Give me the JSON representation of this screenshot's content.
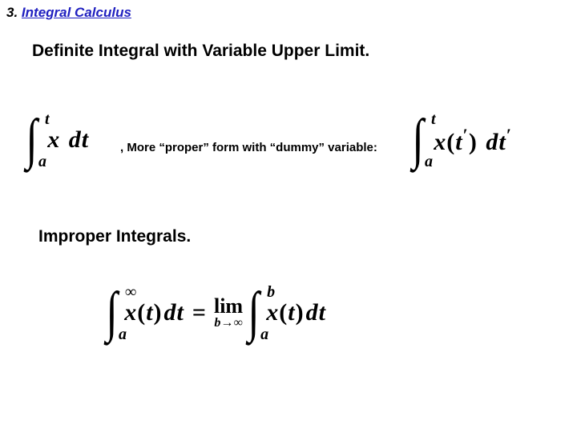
{
  "chapter": {
    "number": "3.",
    "title": "Integral Calculus"
  },
  "heading1": "Definite Integral with Variable Upper Limit.",
  "middle_note": ", More “proper” form with “dummy” variable:",
  "heading2": "Improper Integrals.",
  "eq1": {
    "lower": "a",
    "upper": "t",
    "integrand": "x",
    "diff": "dt"
  },
  "eq2": {
    "lower": "a",
    "upper": "t",
    "integrand_fn": "x",
    "arg": "t",
    "prime": "′",
    "diff_var": "t"
  },
  "eq3": {
    "lhs": {
      "lower": "a",
      "upper": "∞",
      "fn": "x",
      "arg": "t",
      "diff": "dt"
    },
    "lim": {
      "word": "lim",
      "sub": "b→∞"
    },
    "rhs": {
      "lower": "a",
      "upper": "b",
      "fn": "x",
      "arg": "t",
      "diff": "dt"
    }
  }
}
